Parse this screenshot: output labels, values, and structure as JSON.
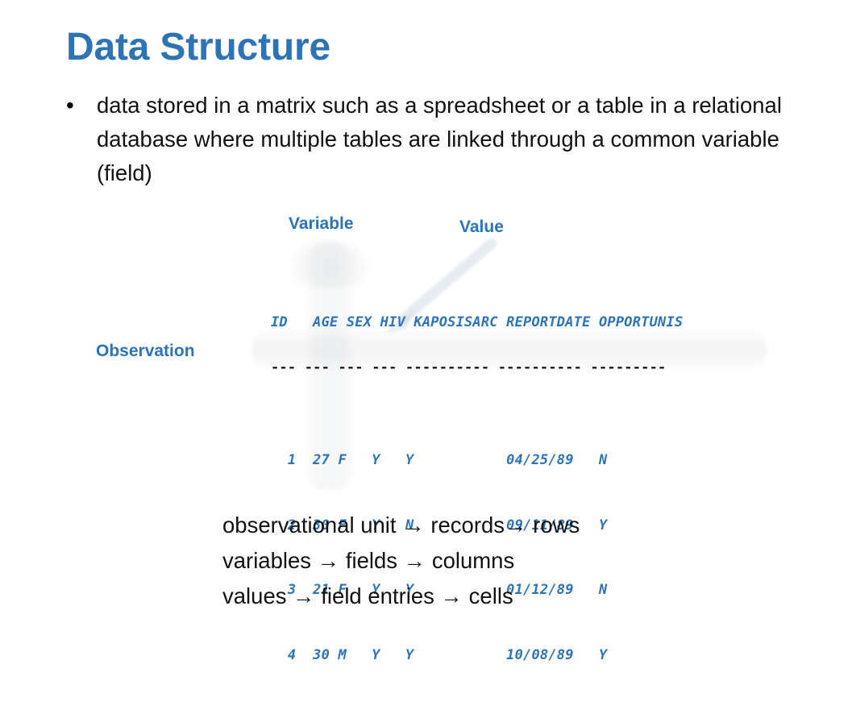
{
  "slide": {
    "title": "Data Structure",
    "bullet": {
      "marker": "•",
      "text": "data stored in a matrix such as a spreadsheet or a table in a relational database where multiple tables are linked through a common variable (field)"
    },
    "callouts": {
      "variable": "Variable",
      "value": "Value",
      "observation": "Observation"
    },
    "listing": {
      "header": "ID   AGE SEX HIV KAPOSISARC REPORTDATE OPPORTUNIS",
      "rule": "--- --- --- --- ---------- ---------- ---------",
      "rows": [
        "  1  27 F   Y   Y           04/25/89   N",
        "  2  30 F   Y   N           09/11/89   Y",
        "  3  21 F   Y   Y           01/12/89   N",
        "  4  30 M   Y   Y           10/08/89   Y"
      ],
      "columns": [
        "ID",
        "AGE",
        "SEX",
        "HIV",
        "KAPOSISARC",
        "REPORTDATE",
        "OPPORTUNIS"
      ],
      "records": [
        {
          "ID": "1",
          "AGE": "27",
          "SEX": "F",
          "HIV": "Y",
          "KAPOSISARC": "Y",
          "REPORTDATE": "04/25/89",
          "OPPORTUNIS": "N"
        },
        {
          "ID": "2",
          "AGE": "30",
          "SEX": "F",
          "HIV": "Y",
          "KAPOSISARC": "N",
          "REPORTDATE": "09/11/89",
          "OPPORTUNIS": "Y"
        },
        {
          "ID": "3",
          "AGE": "21",
          "SEX": "F",
          "HIV": "Y",
          "KAPOSISARC": "Y",
          "REPORTDATE": "01/12/89",
          "OPPORTUNIS": "N"
        },
        {
          "ID": "4",
          "AGE": "30",
          "SEX": "M",
          "HIV": "Y",
          "KAPOSISARC": "Y",
          "REPORTDATE": "10/08/89",
          "OPPORTUNIS": "Y"
        }
      ]
    },
    "mapping": {
      "line1": "observational unit → records→ rows",
      "line2": "variables → ﬁelds → columns",
      "line3": "values → ﬁeld entries → cells"
    },
    "colors": {
      "accent_blue": "#2E74B5",
      "body_text": "#111111",
      "rule_dark": "#1A1A1A",
      "background": "#FFFFFF"
    },
    "icons": {
      "down_arrow": "down-arrow-ghost",
      "diagonal_arrow": "diagonal-arrow-ghost"
    }
  }
}
